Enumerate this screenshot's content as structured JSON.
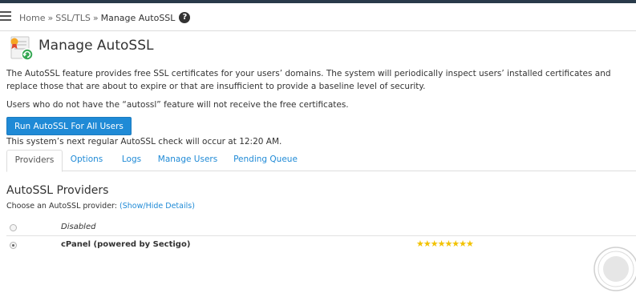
{
  "breadcrumb": {
    "items": [
      "Home",
      "SSL/TLS",
      "Manage AutoSSL"
    ],
    "separator": "»"
  },
  "page": {
    "title": "Manage AutoSSL",
    "description": "The AutoSSL feature provides free SSL certificates for your users’ domains. The system will periodically inspect users’ installed certificates and replace those that are about to expire or that are insufficient to provide a baseline level of security.",
    "feature_note": "Users who do not have the “autossl” feature will not receive the free certificates.",
    "run_button": "Run AutoSSL For All Users",
    "next_check": "This system’s next regular AutoSSL check will occur at 12:20 AM."
  },
  "tabs": [
    "Providers",
    "Options",
    "Logs",
    "Manage Users",
    "Pending Queue"
  ],
  "providers": {
    "title": "AutoSSL Providers",
    "choose_text": "Choose an AutoSSL provider:",
    "toggle_link": "(Show/Hide Details)",
    "rows": [
      {
        "name": "Disabled",
        "selected": false
      },
      {
        "name": "cPanel (powered by Sectigo)",
        "selected": true,
        "rating_stars": 8
      }
    ]
  },
  "colors": {
    "accent": "#1f8ad6",
    "star": "#f2c200",
    "topbar": "#293a4a"
  }
}
